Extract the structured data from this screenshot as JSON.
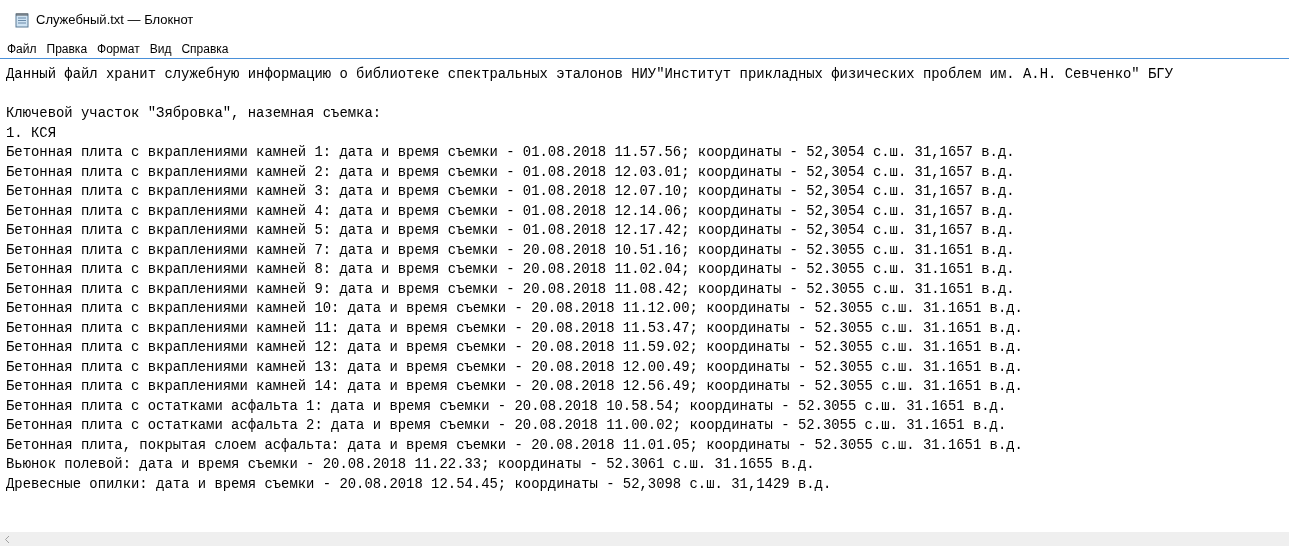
{
  "window": {
    "title": "Служебный.txt — Блокнот"
  },
  "menu": [
    "Файл",
    "Правка",
    "Формат",
    "Вид",
    "Справка"
  ],
  "document": {
    "header": "Данный файл хранит служебную информацию о библиотеке спектральных эталонов НИУ\"Институт прикладных физических проблем им. А.Н. Севченко\" БГУ",
    "lines": [
      "Ключевой участок \"Зябровка\", наземная съемка:",
      "1. КСЯ",
      "Бетонная плита с вкраплениями камней 1: дата и время съемки - 01.08.2018 11.57.56; координаты - 52,3054 с.ш. 31,1657 в.д.",
      "Бетонная плита с вкраплениями камней 2: дата и время съемки - 01.08.2018 12.03.01; координаты - 52,3054 с.ш. 31,1657 в.д.",
      "Бетонная плита с вкраплениями камней 3: дата и время съемки - 01.08.2018 12.07.10; координаты - 52,3054 с.ш. 31,1657 в.д.",
      "Бетонная плита с вкраплениями камней 4: дата и время съемки - 01.08.2018 12.14.06; координаты - 52,3054 с.ш. 31,1657 в.д.",
      "Бетонная плита с вкраплениями камней 5: дата и время съемки - 01.08.2018 12.17.42; координаты - 52,3054 с.ш. 31,1657 в.д.",
      "Бетонная плита с вкраплениями камней 7: дата и время съемки - 20.08.2018 10.51.16; координаты - 52.3055 с.ш. 31.1651 в.д.",
      "Бетонная плита с вкраплениями камней 8: дата и время съемки - 20.08.2018 11.02.04; координаты - 52.3055 с.ш. 31.1651 в.д.",
      "Бетонная плита с вкраплениями камней 9: дата и время съемки - 20.08.2018 11.08.42; координаты - 52.3055 с.ш. 31.1651 в.д.",
      "Бетонная плита с вкраплениями камней 10: дата и время съемки - 20.08.2018 11.12.00; координаты - 52.3055 с.ш. 31.1651 в.д.",
      "Бетонная плита с вкраплениями камней 11: дата и время съемки - 20.08.2018 11.53.47; координаты - 52.3055 с.ш. 31.1651 в.д.",
      "Бетонная плита с вкраплениями камней 12: дата и время съемки - 20.08.2018 11.59.02; координаты - 52.3055 с.ш. 31.1651 в.д.",
      "Бетонная плита с вкраплениями камней 13: дата и время съемки - 20.08.2018 12.00.49; координаты - 52.3055 с.ш. 31.1651 в.д.",
      "Бетонная плита с вкраплениями камней 14: дата и время съемки - 20.08.2018 12.56.49; координаты - 52.3055 с.ш. 31.1651 в.д.",
      "Бетонная плита с остатками асфальта 1: дата и время съемки - 20.08.2018 10.58.54; координаты - 52.3055 с.ш. 31.1651 в.д.",
      "Бетонная плита с остатками асфальта 2: дата и время съемки - 20.08.2018 11.00.02; координаты - 52.3055 с.ш. 31.1651 в.д.",
      "Бетонная плита, покрытая слоем асфальта: дата и время съемки - 20.08.2018 11.01.05; координаты - 52.3055 с.ш. 31.1651 в.д.",
      "Вьюнок полевой: дата и время съемки - 20.08.2018 11.22.33; координаты - 52.3061 с.ш. 31.1655 в.д.",
      "Древесные опилки: дата и время съемки - 20.08.2018 12.54.45; координаты - 52,3098 с.ш. 31,1429 в.д."
    ]
  }
}
